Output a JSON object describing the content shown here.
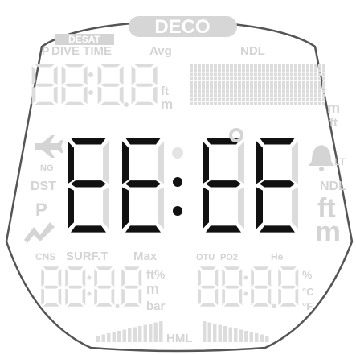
{
  "badges": {
    "deco": "DECO",
    "desat": "DESAT"
  },
  "labels": {
    "p": "P",
    "dive_time": "DIVE TIME",
    "avg": "Avg",
    "ndl_top": "NDL",
    "ng": "NG",
    "dst": "DST",
    "p_left": "P",
    "lt": "LT",
    "ndl_right": "NDL",
    "cns": "CNS",
    "surf_t": "SURF.T",
    "max": "Max",
    "otu": "OTU",
    "po2": "PO2",
    "he": "He",
    "hml": "HML"
  },
  "units": {
    "upper_ft": "ft",
    "upper_m": "m",
    "right_m": "m",
    "right_ft": "ft",
    "big_ft": "ft",
    "big_m": "m",
    "lower_ft_pct": "ft%",
    "lower_m": "m",
    "lower_bar": "bar",
    "pct": "%",
    "deg_c": "°C",
    "deg_f": "°F"
  },
  "main_display": {
    "left": "EE",
    "right": "EE",
    "separator": ":"
  },
  "ghost_digits": {
    "dive_time": "88:8.8",
    "lower_left": "88:8.8",
    "lower_right": "88:8.8"
  },
  "colors": {
    "lit_segment": "#111111",
    "unlit_segment": "#dcdcdc",
    "bezel": "#555555"
  },
  "icons": [
    "airplane-icon",
    "bell-icon",
    "graph-trend-icon"
  ]
}
